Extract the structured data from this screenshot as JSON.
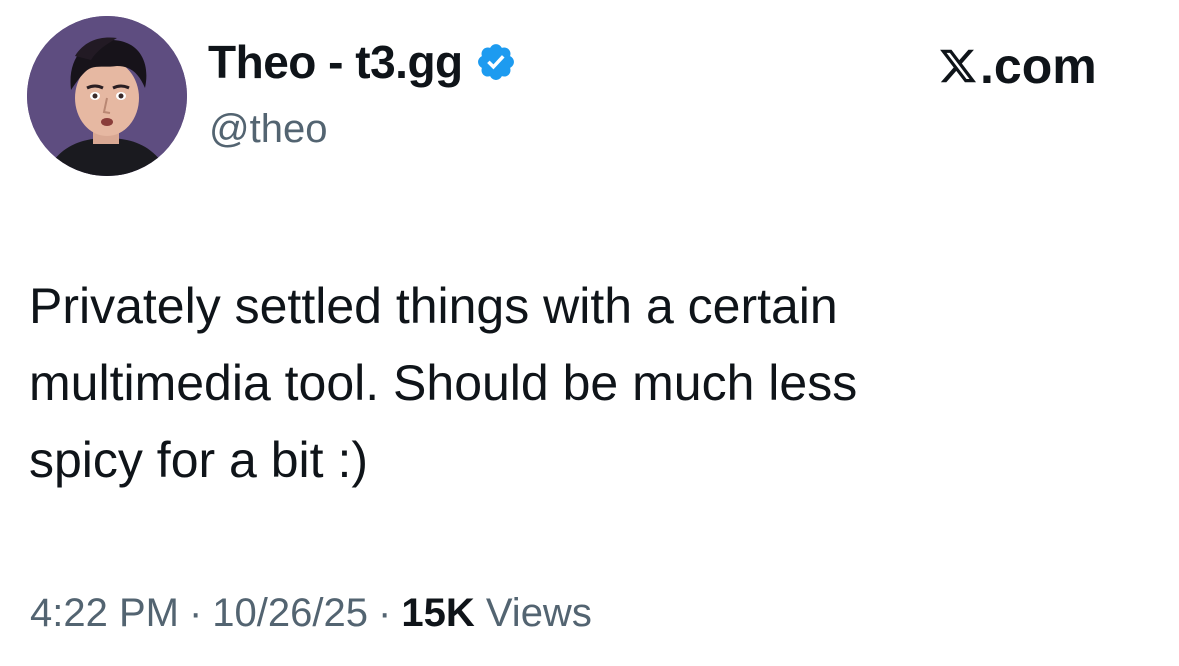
{
  "author": {
    "display_name": "Theo - t3.gg",
    "handle": "@theo",
    "verified_icon": "verified-badge-icon",
    "avatar": "profile-photo"
  },
  "brand": {
    "label": ".com",
    "logo_icon": "x-logo-icon"
  },
  "tweet": {
    "lines": [
      "Privately settled things with a certain",
      "multimedia tool. Should be much less",
      "spicy for a bit :)"
    ]
  },
  "meta": {
    "time": "4:22 PM",
    "separator": "·",
    "date": "10/26/25",
    "views_count": "15K",
    "views_label": "Views"
  },
  "colors": {
    "text": "#0f1419",
    "secondary": "#536471",
    "verified": "#1d9bf0",
    "background": "#ffffff"
  }
}
